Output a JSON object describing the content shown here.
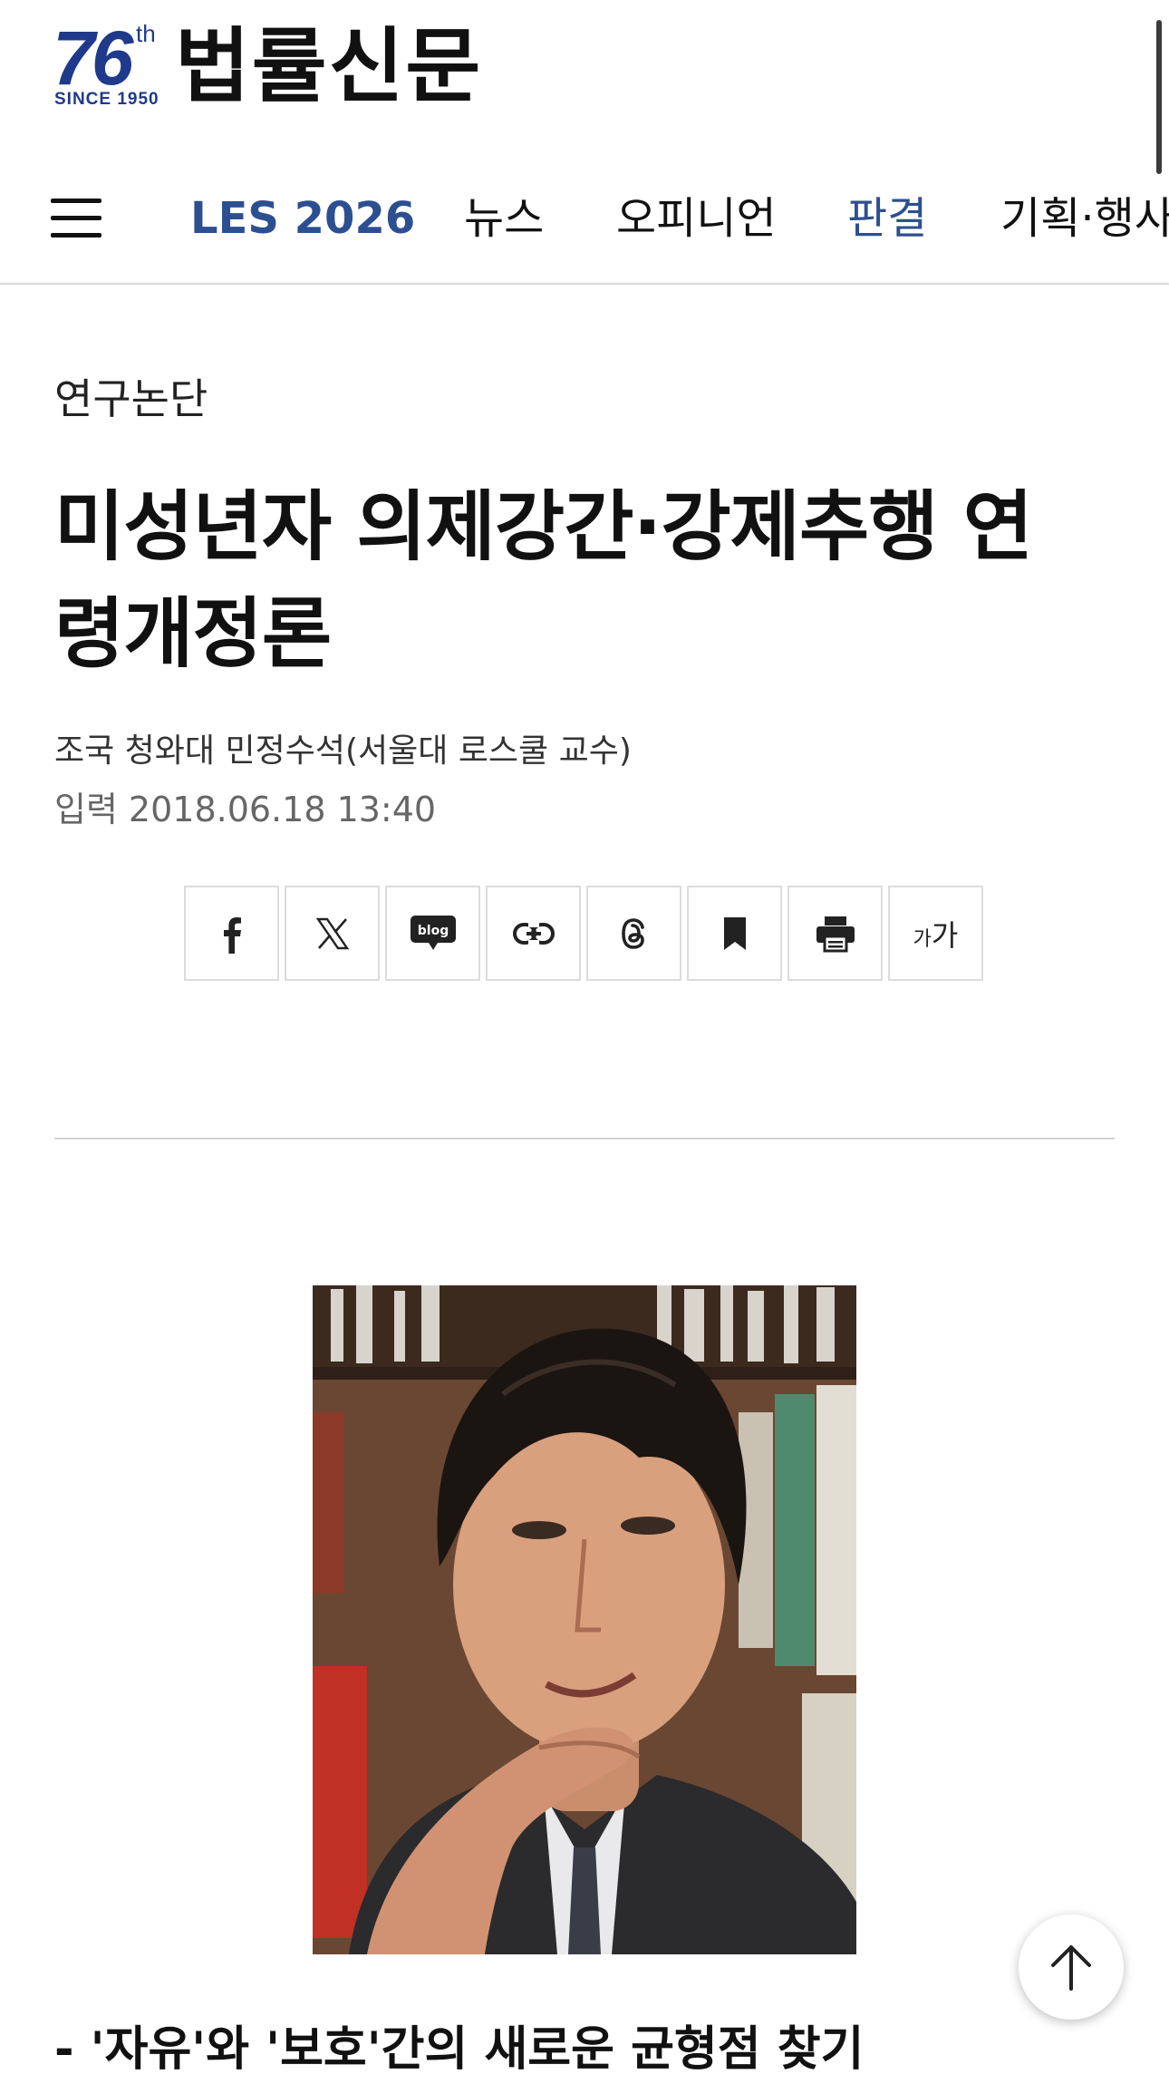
{
  "header": {
    "logo_number": "76",
    "logo_ordinal": "th",
    "logo_since": "SINCE 1950",
    "site_name": "법률신문"
  },
  "nav": {
    "items": [
      {
        "label": "LES 2026"
      },
      {
        "label": "뉴스"
      },
      {
        "label": "오피니언"
      },
      {
        "label": "판결"
      },
      {
        "label": "기획·행사"
      }
    ]
  },
  "article": {
    "category": "연구논단",
    "title": "미성년자 의제강간·강제추행 연령개정론",
    "byline": "조국 청와대 민정수석(서울대 로스쿨 교수)",
    "date_label": "입력",
    "date_value": "2018.06.18 13:40",
    "subtitle": "- '자유'와 '보호'간의 새로운 균형점 찾기"
  },
  "share": {
    "blog_label": "blog",
    "font_small": "가",
    "font_large": "가"
  },
  "colors": {
    "brand_blue": "#2c4f91",
    "logo_blue": "#1f3a8a"
  },
  "icons": [
    "menu-icon",
    "facebook-icon",
    "x-icon",
    "blog-icon",
    "link-icon",
    "threads-icon",
    "bookmark-icon",
    "print-icon",
    "font-size-icon",
    "arrow-up-icon"
  ]
}
